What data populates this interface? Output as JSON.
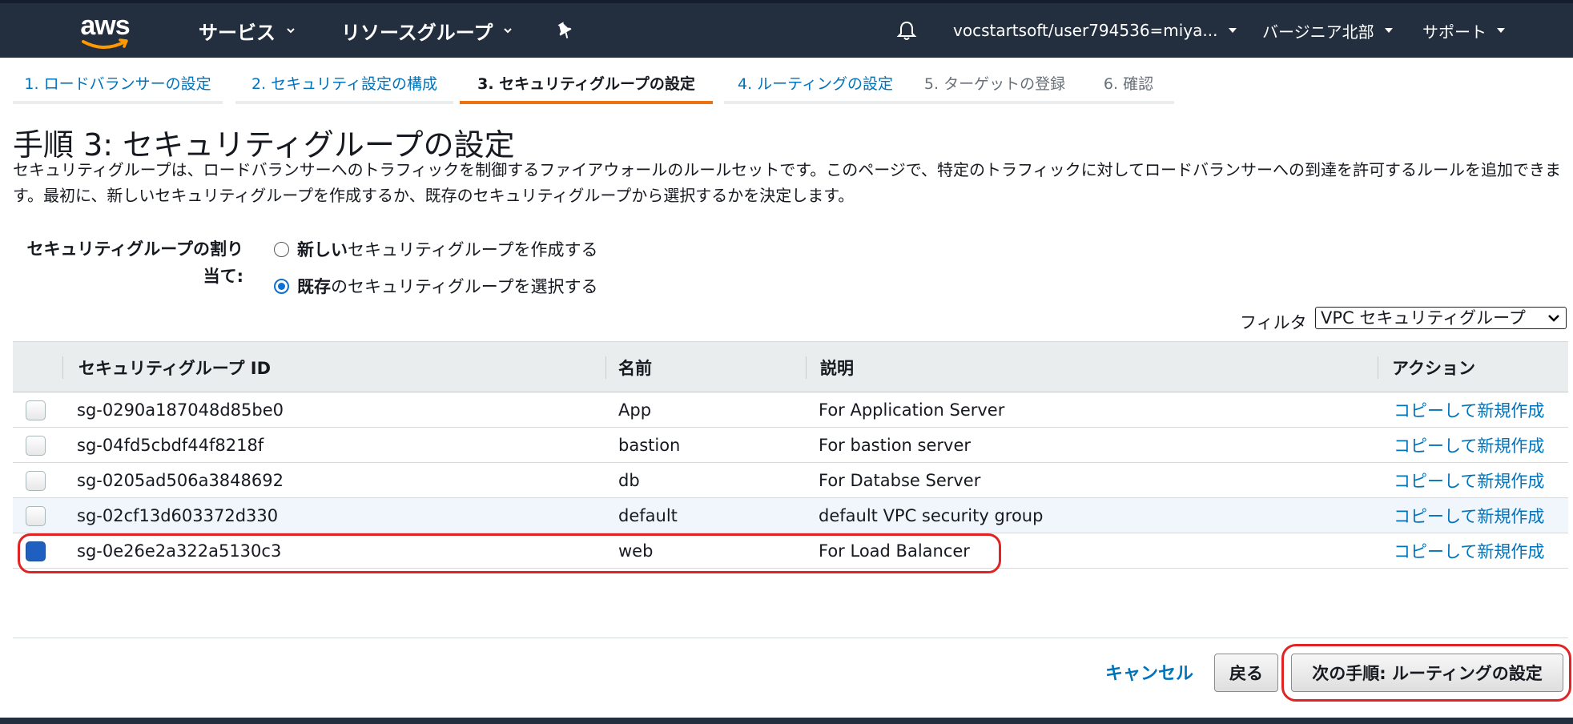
{
  "nav": {
    "logo": "aws",
    "services": "サービス",
    "resource_groups": "リソースグループ",
    "account": "vocstartsoft/user794536=miya...",
    "region": "バージニア北部",
    "support": "サポート",
    "icons": [
      "pin-icon",
      "bell-icon",
      "chevron-down-icon"
    ]
  },
  "steps": [
    {
      "label": "1. ロードバランサーの設定",
      "state": "link"
    },
    {
      "label": "2. セキュリティ設定の構成",
      "state": "link"
    },
    {
      "label": "3. セキュリティグループの設定",
      "state": "active"
    },
    {
      "label": "4. ルーティングの設定",
      "state": "link"
    },
    {
      "label": "5. ターゲットの登録",
      "state": "disabled"
    },
    {
      "label": "6. 確認",
      "state": "disabled"
    }
  ],
  "page": {
    "title": "手順 3: セキュリティグループの設定",
    "description": "セキュリティグループは、ロードバランサーへのトラフィックを制御するファイアウォールのルールセットです。このページで、特定のトラフィックに対してロードバランサーへの到達を許可するルールを追加できます。最初に、新しいセキュリティグループを作成するか、既存のセキュリティグループから選択するかを決定します。"
  },
  "assignment": {
    "label": "セキュリティグループの割り当て:",
    "options": [
      {
        "bold": "新しい",
        "rest": "セキュリティグループを作成する",
        "checked": false
      },
      {
        "bold": "既存",
        "rest": "のセキュリティグループを選択する",
        "checked": true
      }
    ]
  },
  "filter": {
    "label": "フィルタ",
    "selected": "VPC セキュリティグループ"
  },
  "table": {
    "headers": [
      "セキュリティグループ ID",
      "名前",
      "説明",
      "アクション"
    ],
    "rows": [
      {
        "id": "sg-0290a187048d85be0",
        "name": "App",
        "desc": "For Application Server",
        "action": "コピーして新規作成",
        "checked": false
      },
      {
        "id": "sg-04fd5cbdf44f8218f",
        "name": "bastion",
        "desc": "For bastion server",
        "action": "コピーして新規作成",
        "checked": false
      },
      {
        "id": "sg-0205ad506a3848692",
        "name": "db",
        "desc": "For Databse Server",
        "action": "コピーして新規作成",
        "checked": false
      },
      {
        "id": "sg-02cf13d603372d330",
        "name": "default",
        "desc": "default VPC security group",
        "action": "コピーして新規作成",
        "checked": false
      },
      {
        "id": "sg-0e26e2a322a5130c3",
        "name": "web",
        "desc": "For Load Balancer",
        "action": "コピーして新規作成",
        "checked": true
      }
    ]
  },
  "footer": {
    "cancel": "キャンセル",
    "back": "戻る",
    "next": "次の手順: ルーティングの設定"
  },
  "colors": {
    "nav_bg": "#232f3e",
    "link": "#0073bb",
    "active_step": "#ec7211",
    "highlight": "#e02424"
  }
}
